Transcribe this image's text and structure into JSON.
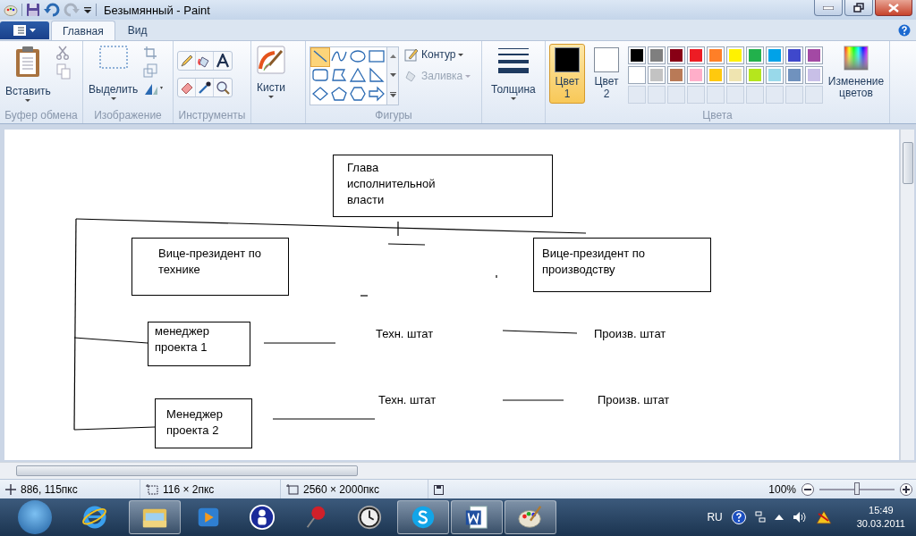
{
  "window": {
    "title": "Безымянный - Paint"
  },
  "tabs": [
    {
      "label": "Главная",
      "selected": true
    },
    {
      "label": "Вид",
      "selected": false
    }
  ],
  "ribbon": {
    "groups": [
      {
        "kind": "clipboard",
        "label": "Буфер обмена",
        "button": "Вставить"
      },
      {
        "kind": "image",
        "label": "Изображение",
        "button": "Выделить"
      },
      {
        "kind": "tools",
        "label": "Инструменты"
      },
      {
        "kind": "brushes",
        "button": "Кисти"
      },
      {
        "kind": "shapes",
        "label": "Фигуры",
        "outline": "Контур",
        "fill": {
          "label": "Заливка",
          "disabled": true
        },
        "shapes": [
          {
            "kind": "line",
            "selected": true
          },
          {
            "kind": "curve",
            "selected": false
          },
          {
            "kind": "oval",
            "selected": false
          },
          {
            "kind": "rect",
            "selected": false
          },
          {
            "kind": "roundrect",
            "selected": false
          },
          {
            "kind": "polygon",
            "selected": false
          },
          {
            "kind": "triangle",
            "selected": false
          },
          {
            "kind": "righttriangle",
            "selected": false
          },
          {
            "kind": "diamond",
            "selected": false
          },
          {
            "kind": "pentagon",
            "selected": false
          },
          {
            "kind": "hexagon",
            "selected": false
          },
          {
            "kind": "arrow",
            "selected": false
          }
        ]
      },
      {
        "kind": "size",
        "button": "Толщина"
      },
      {
        "kind": "colors",
        "label": "Цвета",
        "slots": [
          {
            "label": "Цвет",
            "number": "1",
            "color": "#000000",
            "selected": true
          },
          {
            "label": "Цвет",
            "number": "2",
            "color": "#ffffff",
            "selected": false
          }
        ],
        "palette": [
          {
            "color": "#000000"
          },
          {
            "color": "#7f7f7f"
          },
          {
            "color": "#880015"
          },
          {
            "color": "#ed1c24"
          },
          {
            "color": "#ff7f27"
          },
          {
            "color": "#fff200"
          },
          {
            "color": "#22b14c"
          },
          {
            "color": "#00a2e8"
          },
          {
            "color": "#3f48cc"
          },
          {
            "color": "#a349a4"
          },
          {
            "color": "#ffffff"
          },
          {
            "color": "#c3c3c3"
          },
          {
            "color": "#b97a57"
          },
          {
            "color": "#ffaec9"
          },
          {
            "color": "#ffc90e"
          },
          {
            "color": "#efe4b0"
          },
          {
            "color": "#b5e61d"
          },
          {
            "color": "#99d9ea"
          },
          {
            "color": "#7092be"
          },
          {
            "color": "#c8bfe7"
          }
        ],
        "edit_button": "Изменение цветов"
      }
    ]
  },
  "canvas": {
    "boxes": [
      {
        "text": "Глава исполнительной власти"
      },
      {
        "text": "Вице-президент по технике"
      },
      {
        "text": "Вице-президент по производству"
      },
      {
        "text": "менеджер проекта 1"
      },
      {
        "text": "Менеджер проекта 2"
      }
    ],
    "labels": [
      {
        "text": "Техн. штат"
      },
      {
        "text": "Произв. штат"
      },
      {
        "text": "Техн. штат"
      },
      {
        "text": "Произв. штат"
      }
    ]
  },
  "status_bar": {
    "cursor": "886, 115пкс",
    "selection": "116 × 2пкс",
    "image_size": "2560 × 2000пкс",
    "zoom": "100%",
    "zoom_slider": {
      "level": 0.5
    }
  },
  "taskbar": {
    "apps": [
      {
        "kind": "explorer",
        "open": true
      },
      {
        "kind": "media",
        "open": false
      },
      {
        "kind": "user",
        "open": false
      },
      {
        "kind": "pin",
        "open": false
      },
      {
        "kind": "clock",
        "open": false
      },
      {
        "kind": "skype",
        "open": true
      },
      {
        "kind": "word",
        "open": true
      },
      {
        "kind": "paint",
        "open": true
      }
    ],
    "language": "RU",
    "time": "15:49",
    "date": "30.03.2011"
  }
}
